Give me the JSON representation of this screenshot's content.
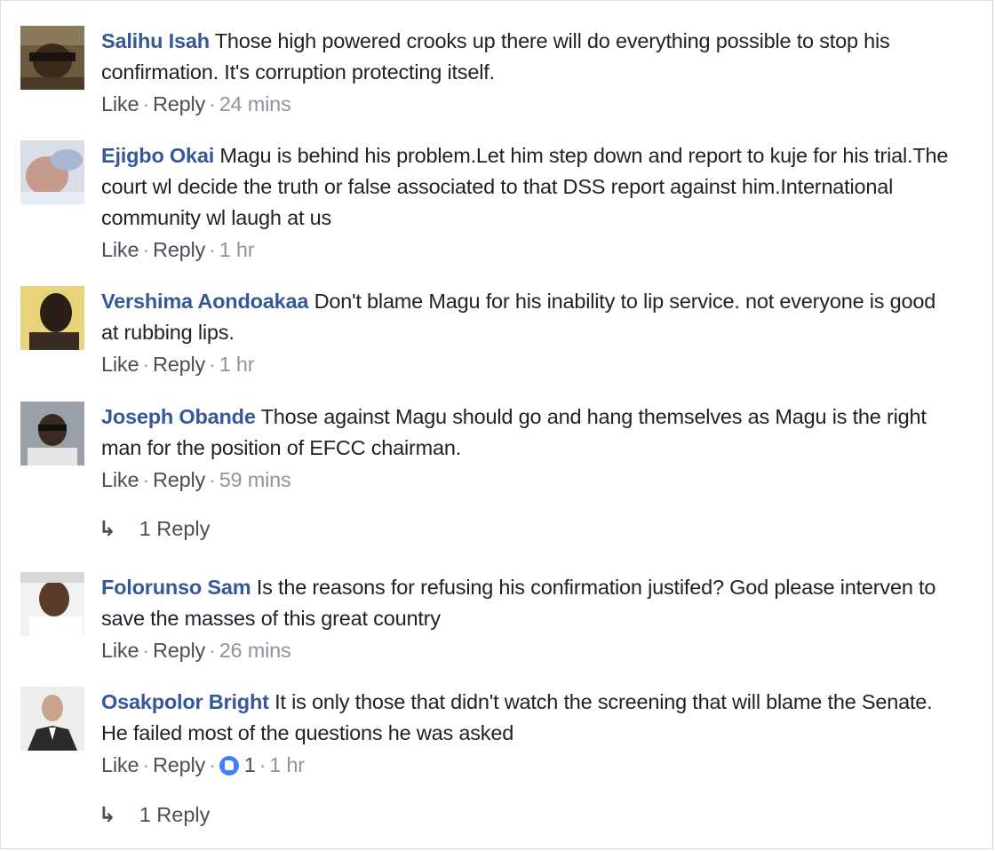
{
  "comments": [
    {
      "author": "Salihu Isah",
      "text": "Those high powered crooks up there will do everything possible to stop his confirmation. It's corruption protecting itself.",
      "like": "Like",
      "reply": "Reply",
      "time": "24 mins"
    },
    {
      "author": "Ejigbo Okai",
      "text": "Magu is behind his problem.Let him step down and report to kuje for his trial.The court wl decide the truth or false associated to that DSS report against him.International community wl laugh at us",
      "like": "Like",
      "reply": "Reply",
      "time": "1 hr"
    },
    {
      "author": "Vershima Aondoakaa",
      "text": "Don't blame Magu for his inability to lip service. not everyone is good at rubbing lips.",
      "like": "Like",
      "reply": "Reply",
      "time": "1 hr"
    },
    {
      "author": "Joseph Obande",
      "text": "Those against Magu should go and hang themselves as Magu is the right man for the position of EFCC chairman.",
      "like": "Like",
      "reply": "Reply",
      "time": "59 mins",
      "replies_label": "1 Reply"
    },
    {
      "author": "Folorunso Sam",
      "text": "Is the reasons for refusing his confirmation justifed? God please interven to save the masses of this great country",
      "like": "Like",
      "reply": "Reply",
      "time": "26 mins"
    },
    {
      "author": "Osakpolor Bright",
      "text": "It is only those that didn't watch the screening that will blame the Senate. He failed most of the questions he was asked",
      "like": "Like",
      "reply": "Reply",
      "reaction_count": "1",
      "reaction_icon": "like-reaction-icon",
      "time": "1 hr",
      "replies_label": "1 Reply"
    }
  ],
  "separator": "·",
  "reply_arrow": "↳",
  "colors": {
    "author": "#365899",
    "meta": "#90949c",
    "link": "#4b4f56",
    "reaction": "#4080ff"
  }
}
